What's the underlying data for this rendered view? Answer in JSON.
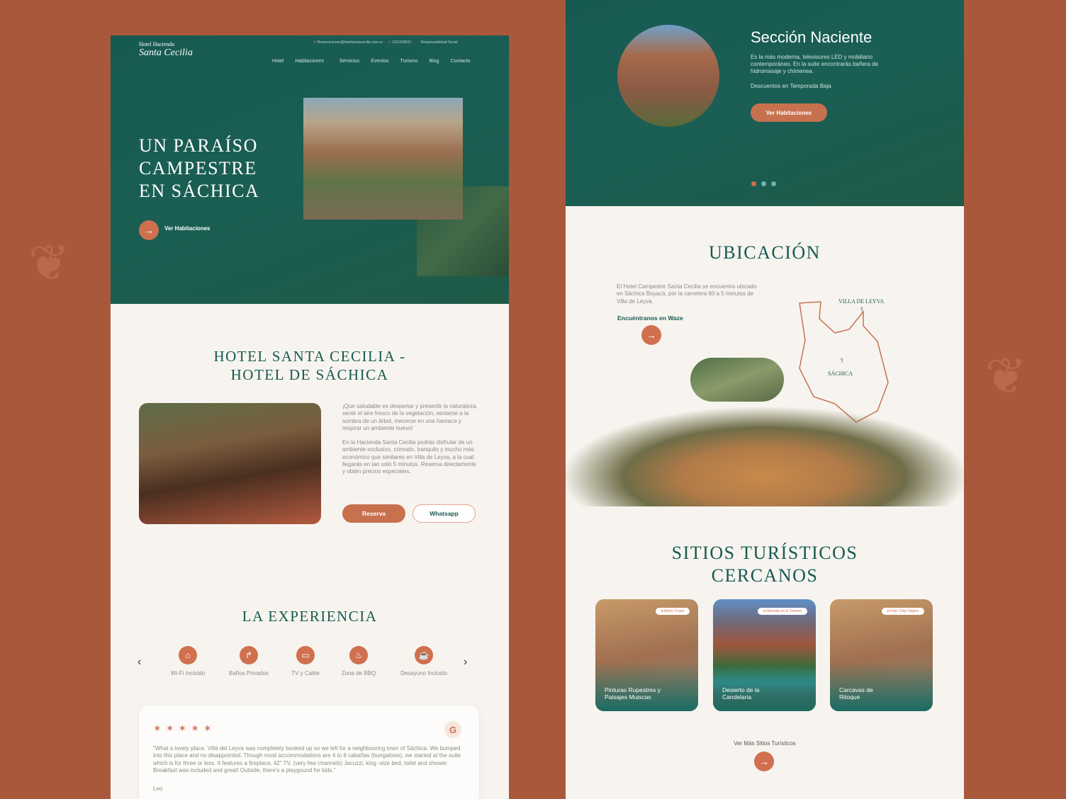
{
  "colors": {
    "background": "#a9583b",
    "primary_green": "#175a52",
    "accent": "#d0704f",
    "cream": "#f7f4ef"
  },
  "left_page": {
    "logo": {
      "line1": "Hotel Hacienda",
      "line2": "Santa Cecilia"
    },
    "topbar": {
      "email": "Reservaciones@hotelsantacecilia.com.co",
      "phone": "3112156611",
      "social": "Responsabilidad Social"
    },
    "nav": [
      "Hotel",
      "Habitaciones",
      "Servicios",
      "Eventos",
      "Turismo",
      "Blog",
      "Contacto"
    ],
    "hero": {
      "title_lines": [
        "UN PARAÍSO",
        "CAMPESTRE",
        "EN SÁCHICA"
      ],
      "cta": "Ver Habitaciones"
    },
    "about": {
      "title_lines": [
        "HOTEL SANTA CECILIA -",
        "HOTEL DE SÁCHICA"
      ],
      "p1": "¡Que saludable es despertar y presentir la naturaleza, sentir el aire fresco de la vegetación, sentarse a la sombra de un árbol, mecerse en una hamaca y respirar un ambiente nuevo!",
      "p2": "En la Hacienda Santa Cecilia podrás disfrutar de un ambiente exclusivo, cómodo, tranquilo y mucho más económico que similares en Villa de Leyva, a la cual llegarás en tan solo 5 minutos. Reserva directamente y obtén precios especiales.",
      "reserve": "Reserva",
      "whatsapp": "Whatsapp"
    },
    "experience": {
      "title": "LA EXPERIENCIA",
      "amenities": [
        {
          "label": "Wi-Fi Incluido",
          "icon": "wifi-house-icon"
        },
        {
          "label": "Baños Privados",
          "icon": "shower-icon"
        },
        {
          "label": "TV y Cable",
          "icon": "tv-icon"
        },
        {
          "label": "Zona de BBQ",
          "icon": "bbq-icon"
        },
        {
          "label": "Desayuno Incluido",
          "icon": "coffee-cup-icon"
        }
      ]
    },
    "review": {
      "rating": 5,
      "source_icon": "google-icon",
      "text": "\"What a lovely place. Villa del Leyva was completely booked up so we left for a neighbouring town of Sáchica. We bumped into this place and no disappointed. Though most accommodations are 4 to 6 cabañas (bungalows), we started at the suite which is for three or less. It features a fireplace, 42\" TV, (very few channels) Jacuzzi, king -size bed, toilet and shower. Breakfast was included and great! Outside, there's a playgound for kids.\"",
      "author": "Leo"
    }
  },
  "right_page": {
    "section": {
      "title": "Sección Naciente",
      "desc": "Es la más moderna, televisores LED y mobiliario contemporáneo. En la suite encontrarás bañera de hidromasaje y chimenea.",
      "discount": "Descuentos en Temporada Baja",
      "cta": "Ver Habitaciones",
      "slides": 3,
      "active_slide": 1
    },
    "location": {
      "title": "UBICACIÓN",
      "desc": "El Hotel Campestre Santa Cecilia se encuentra ubicado en Sáchica Boyacá, por la carretera 60 a 5 minutos de Villa de Leyva.",
      "waze": "Encuéntranos en Waze",
      "map_labels": [
        "VILLA DE LEYVA",
        "SÁCHICA"
      ]
    },
    "sites": {
      "title_lines": [
        "SITIOS TURÍSTICOS",
        "CERCANOS"
      ],
      "cards": [
        {
          "title": "Pinturas Rupestres y Paisajes Muiscas",
          "credit": "Bohio Travel"
        },
        {
          "title": "Desierto de la Candelaria",
          "credit": "Nómada en el Camino"
        },
        {
          "title": "Carcavas de Ritoque",
          "credit": "Foto: Chip Viajero"
        }
      ],
      "more": "Ver Más Sitios Turísticos"
    }
  }
}
